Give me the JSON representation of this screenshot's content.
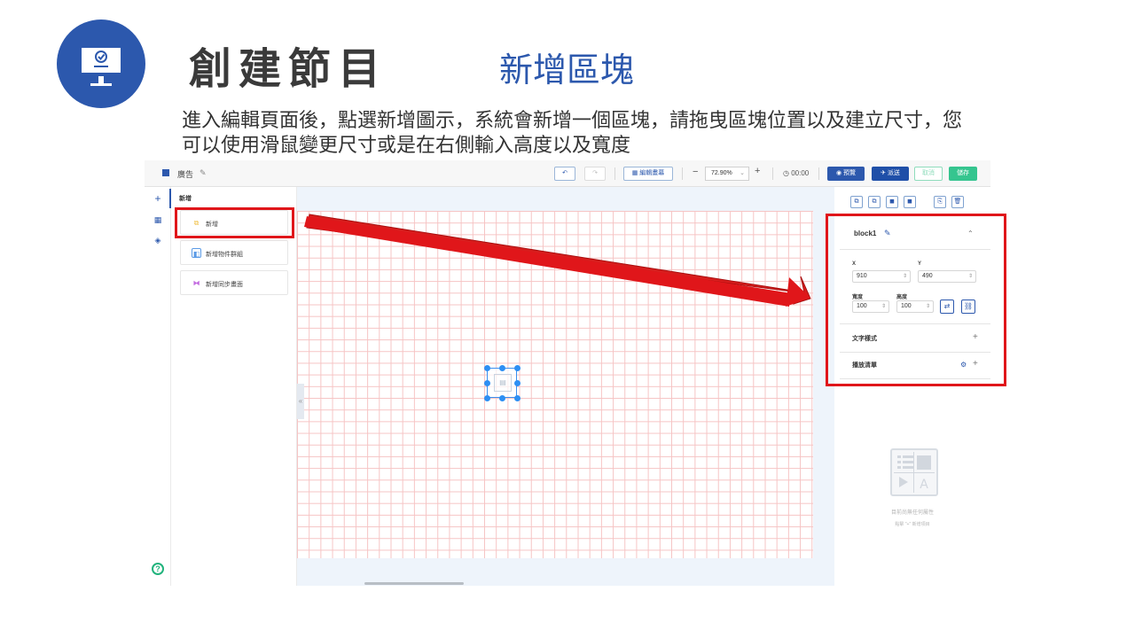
{
  "slide": {
    "title": "創建節目",
    "subtitle": "新增區塊",
    "description": "進入編輯頁面後，點選新增圖示，系統會新增一個區塊，請拖曳區塊位置以及建立尺寸，您可以使用滑鼠變更尺寸或是在右側輸入高度以及寬度",
    "brand_color": "#2c58ad",
    "annotation_color": "#e0161a"
  },
  "app": {
    "topbar": {
      "name": "廣告",
      "edit_layout_label": "編輯畫幕",
      "zoom_value": "72.90%",
      "time": "00:00",
      "preview_label": "預覽",
      "send_label": "派送",
      "cancel_label": "取消",
      "save_label": "儲存",
      "icons": [
        "windows-icon",
        "pencil-icon",
        "undo-icon",
        "redo-icon",
        "layout-icon",
        "zoom-out-icon",
        "dropdown-icon",
        "zoom-in-icon",
        "clock-icon",
        "preview-icon",
        "send-icon"
      ]
    },
    "left_panel": {
      "header": "新增",
      "items": [
        {
          "label": "新增",
          "icon": "add-block-icon",
          "color": "#f0c24b"
        },
        {
          "label": "新增物件群組",
          "icon": "group-icon",
          "color": "#5b9be6"
        },
        {
          "label": "新增同步畫面",
          "icon": "sync-screen-icon",
          "color": "#c36be0"
        }
      ]
    },
    "properties": {
      "block_name": "block1",
      "x_label": "X",
      "x_value": "910",
      "y_label": "Y",
      "y_value": "490",
      "height_label": "寬度",
      "height_value": "100",
      "width_label": "高度",
      "width_value": "100",
      "text_style_label": "文字樣式",
      "playlist_label": "播放清單",
      "empty_message": "目前尚無任何屬性",
      "empty_hint": "點擊 \"+\" 新增項目"
    }
  }
}
